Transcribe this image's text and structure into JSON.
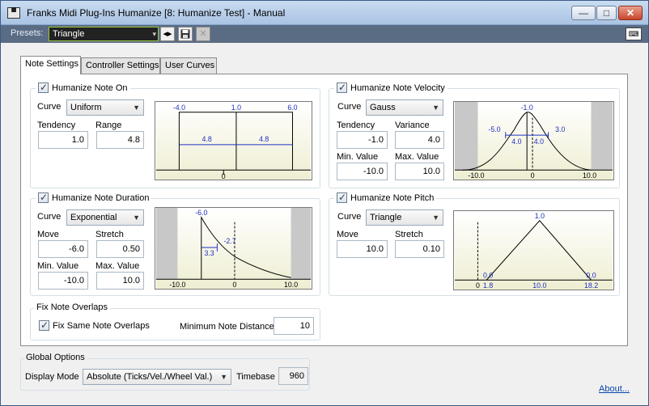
{
  "window": {
    "title": "Franks Midi Plug-Ins Humanize [8: Humanize Test] - Manual",
    "min": "—",
    "max": "□",
    "close": "✕"
  },
  "presets": {
    "label": "Presets:",
    "value": "Triangle",
    "arrow": "▾",
    "nav": "◂▸",
    "save": "💾",
    "delete": "✕",
    "kbd": "⌨"
  },
  "tabs": [
    "Note Settings",
    "Controller Settings",
    "User Curves"
  ],
  "note_on": {
    "title": "Humanize Note On",
    "curve_label": "Curve",
    "curve": "Uniform",
    "tendency_label": "Tendency",
    "tendency": "1.0",
    "range_label": "Range",
    "range": "4.8",
    "graph": {
      "left": "-4.0",
      "mid": "1.0",
      "right": "6.0",
      "w1": "4.8",
      "w2": "4.8",
      "zero": "0"
    }
  },
  "velocity": {
    "title": "Humanize Note Velocity",
    "curve_label": "Curve",
    "curve": "Gauss",
    "tendency_label": "Tendency",
    "tendency": "-1.0",
    "variance_label": "Variance",
    "variance": "4.0",
    "min_label": "Min. Value",
    "min": "-10.0",
    "max_label": "Max. Value",
    "max": "10.0",
    "graph": {
      "top": "-1.0",
      "l": "-5.0",
      "r": "3.0",
      "w1": "4.0",
      "w2": "4.0",
      "xmin": "-10.0",
      "zero": "0",
      "xmax": "10.0"
    }
  },
  "duration": {
    "title": "Humanize Note Duration",
    "curve_label": "Curve",
    "curve": "Exponential",
    "move_label": "Move",
    "move": "-6.0",
    "stretch_label": "Stretch",
    "stretch": "0.50",
    "min_label": "Min. Value",
    "min": "-10.0",
    "max_label": "Max. Value",
    "max": "10.0",
    "graph": {
      "top": "-6.0",
      "mid": "-2.7",
      "w": "3.3",
      "xmin": "-10.0",
      "zero": "0",
      "xmax": "10.0"
    }
  },
  "pitch": {
    "title": "Humanize Note Pitch",
    "curve_label": "Curve",
    "curve": "Triangle",
    "move_label": "Move",
    "move": "10.0",
    "stretch_label": "Stretch",
    "stretch": "0.10",
    "graph": {
      "peak": "1.0",
      "l0": "0.0",
      "r0": "0.0",
      "zero": "0",
      "a": "1.8",
      "b": "10.0",
      "c": "18.2"
    }
  },
  "overlaps": {
    "title": "Fix Note Overlaps",
    "checkbox": "Fix Same Note Overlaps",
    "min_dist_label": "Minimum Note Distance",
    "min_dist": "10"
  },
  "global": {
    "title": "Global Options",
    "mode_label": "Display Mode",
    "mode": "Absolute (Ticks/Vel./Wheel Val.)",
    "timebase_label": "Timebase",
    "timebase": "960"
  },
  "about": "About..."
}
